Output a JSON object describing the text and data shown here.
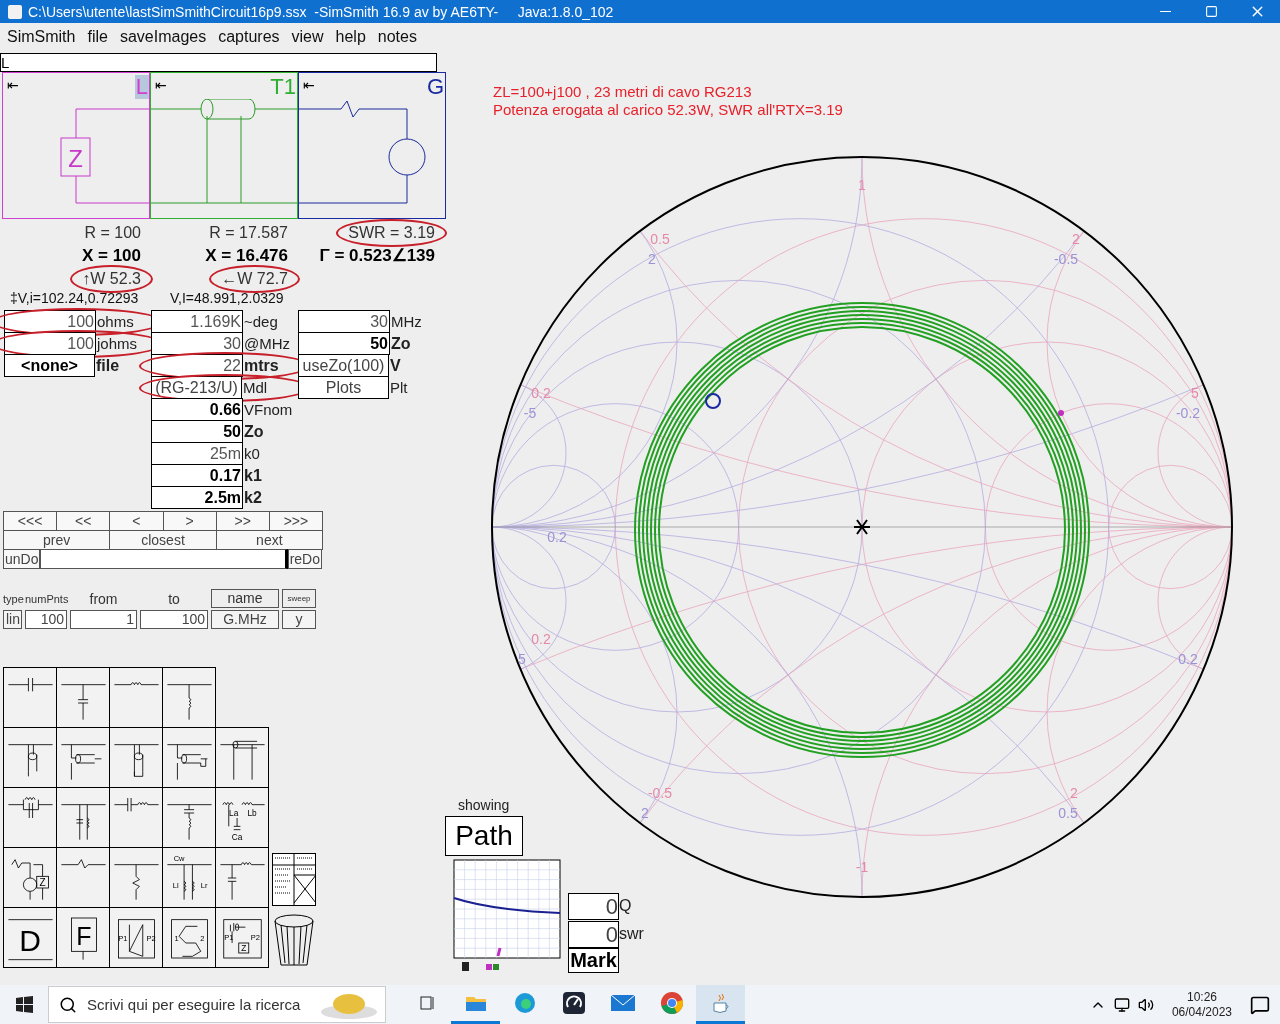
{
  "window": {
    "title": "C:\\Users\\utente\\lastSimSmithCircuit16p9.ssx  -SimSmith 16.9 av by AE6TY-     Java:1.8.0_102"
  },
  "menu": [
    "SimSmith",
    "file",
    "saveImages",
    "captures",
    "view",
    "help",
    "notes"
  ],
  "command_field": {
    "value": "L"
  },
  "circuit": [
    {
      "kind": "load",
      "label": "L",
      "back_mark": "⇤",
      "symbol": "Z",
      "selected": true
    },
    {
      "kind": "line",
      "label": "T1",
      "back_mark": "⇤",
      "selected": false
    },
    {
      "kind": "generator",
      "label": "G",
      "back_mark": "⇤",
      "selected": false
    }
  ],
  "readouts": [
    {
      "lines": [
        {
          "text": "R = 100",
          "circled": false
        },
        {
          "text": "X = 100",
          "circled": false
        },
        {
          "text": "↑W 52.3",
          "circled": true
        }
      ]
    },
    {
      "lines": [
        {
          "text": "R = 17.587",
          "circled": false
        },
        {
          "text": "X = 16.476",
          "circled": false
        },
        {
          "text": "←W 72.7",
          "circled": true
        }
      ]
    },
    {
      "lines": [
        {
          "text": "SWR = 3.19",
          "circled": true
        },
        {
          "text": "Γ = 0.523∠139",
          "circled": false
        }
      ]
    }
  ],
  "vi": [
    "‡V,i=102.24,0.72293",
    "V,I=48.991,2.0329"
  ],
  "field_groups": [
    {
      "fields": [
        {
          "kind": "input",
          "value": "100",
          "unit": "ohms",
          "bold": false,
          "unit_bold": false,
          "circled": true
        },
        {
          "kind": "input",
          "value": "100",
          "unit": "johms",
          "bold": false,
          "unit_bold": false,
          "circled": true
        },
        {
          "kind": "button",
          "value": "<none>",
          "unit": "file",
          "bold": true,
          "unit_bold": true,
          "circled": false
        }
      ]
    },
    {
      "fields": [
        {
          "kind": "input",
          "value": "1.169K",
          "unit": "~deg",
          "bold": false,
          "unit_bold": false,
          "circled": false
        },
        {
          "kind": "input",
          "value": "30",
          "unit": "@MHz",
          "bold": false,
          "unit_bold": false,
          "circled": false
        },
        {
          "kind": "input",
          "value": "22",
          "unit": "mtrs",
          "bold": false,
          "unit_bold": true,
          "circled": true
        },
        {
          "kind": "button",
          "value": "(RG-213/U)",
          "unit": "Mdl",
          "bold": false,
          "unit_bold": false,
          "circled": true
        },
        {
          "kind": "input",
          "value": "0.66",
          "unit": "VFnom",
          "bold": true,
          "unit_bold": false,
          "circled": false
        },
        {
          "kind": "input",
          "value": "50",
          "unit": "Zo",
          "bold": true,
          "unit_bold": true,
          "circled": false
        },
        {
          "kind": "input",
          "value": "25m",
          "unit": "k0",
          "bold": false,
          "unit_bold": false,
          "circled": false
        },
        {
          "kind": "input",
          "value": "0.17",
          "unit": "k1",
          "bold": true,
          "unit_bold": true,
          "circled": false
        },
        {
          "kind": "input",
          "value": "2.5m",
          "unit": "k2",
          "bold": true,
          "unit_bold": true,
          "circled": false
        }
      ]
    },
    {
      "fields": [
        {
          "kind": "input",
          "value": "30",
          "unit": "MHz",
          "bold": false,
          "unit_bold": false,
          "circled": false
        },
        {
          "kind": "input",
          "value": "50",
          "unit": "Zo",
          "bold": true,
          "unit_bold": true,
          "circled": false
        },
        {
          "kind": "button",
          "value": "useZo(100)",
          "unit": "V",
          "bold": false,
          "unit_bold": true,
          "circled": false
        },
        {
          "kind": "button",
          "value": "Plots",
          "unit": "Plt",
          "bold": false,
          "unit_bold": false,
          "circled": false
        }
      ]
    }
  ],
  "nav": {
    "step_buttons": [
      "<<<",
      "<<",
      "<",
      ">",
      ">>",
      ">>>"
    ],
    "search_buttons": [
      "prev",
      "closest",
      "next"
    ],
    "undo": "unDo",
    "redo": "reDo"
  },
  "sweep": {
    "headers": [
      {
        "text": "type",
        "kind": "small"
      },
      {
        "text": "numPnts",
        "kind": "small"
      },
      {
        "text": "from",
        "kind": "plain"
      },
      {
        "text": "to",
        "kind": "plain"
      },
      {
        "text": "name",
        "kind": "boxed"
      },
      {
        "text": "sweep",
        "kind": "tiny"
      }
    ],
    "values": [
      {
        "text": "lin",
        "kind": "button"
      },
      {
        "text": "100",
        "kind": "input"
      },
      {
        "text": "1",
        "kind": "input"
      },
      {
        "text": "100",
        "kind": "input"
      },
      {
        "text": "G.MHz",
        "kind": "button"
      },
      {
        "text": "y",
        "kind": "button"
      }
    ]
  },
  "palette": [
    [
      {
        "kind": "series-c"
      },
      {
        "kind": "shunt-c"
      },
      {
        "kind": "series-l"
      },
      {
        "kind": "shunt-l"
      }
    ],
    [
      {
        "kind": "stub-open"
      },
      {
        "kind": "line-open"
      },
      {
        "kind": "stub-short"
      },
      {
        "kind": "line-short"
      },
      {
        "kind": "tline"
      }
    ],
    [
      {
        "kind": "parallel-lc-series"
      },
      {
        "kind": "parallel-lc-shunt"
      },
      {
        "kind": "series-lc"
      },
      {
        "kind": "series-lc-shunt"
      },
      {
        "kind": "tee",
        "labels": [
          "La",
          "Lb",
          "Ca"
        ]
      }
    ],
    [
      {
        "kind": "source",
        "labels": [
          "Z"
        ]
      },
      {
        "kind": "series-r"
      },
      {
        "kind": "shunt-r"
      },
      {
        "kind": "coupled",
        "labels": [
          "Cw",
          "Ll",
          "Lr"
        ]
      },
      {
        "kind": "lowpass"
      }
    ],
    [
      {
        "kind": "letter-box",
        "labels": [
          "D"
        ]
      },
      {
        "kind": "framed-letter",
        "labels": [
          "F"
        ]
      },
      {
        "kind": "n-box",
        "labels": [
          "P1",
          "P2"
        ]
      },
      {
        "kind": "s-box",
        "labels": [
          "1",
          "2"
        ]
      },
      {
        "kind": "network",
        "labels": [
          "P1",
          "P2",
          "Z"
        ]
      }
    ]
  ],
  "annotation": [
    "ZL=100+j100 , 23 metri di cavo RG213",
    "Potenza erogata al carico 52.3W, SWR all'RTX=3.19"
  ],
  "smith": {
    "scale_labels": [
      {
        "text": "1",
        "kind": "impedance"
      },
      {
        "text": "0.5",
        "kind": "impedance"
      },
      {
        "text": "2",
        "kind": "admittance"
      },
      {
        "text": "2",
        "kind": "impedance"
      },
      {
        "text": "-0.5",
        "kind": "admittance"
      },
      {
        "text": "0.2",
        "kind": "impedance"
      },
      {
        "text": "-5",
        "kind": "admittance"
      },
      {
        "text": "5",
        "kind": "impedance"
      },
      {
        "text": "-0.2",
        "kind": "admittance"
      },
      {
        "text": "0.2",
        "kind": "admittance"
      },
      {
        "text": "0.2",
        "kind": "impedance"
      },
      {
        "text": "5",
        "kind": "admittance"
      },
      {
        "text": "0.2",
        "kind": "admittance"
      },
      {
        "text": "-0.5",
        "kind": "impedance"
      },
      {
        "text": "2",
        "kind": "admittance"
      },
      {
        "text": "2",
        "kind": "impedance"
      },
      {
        "text": "0.5",
        "kind": "admittance"
      },
      {
        "text": "-1",
        "kind": "impedance"
      }
    ]
  },
  "path_panel": {
    "caption": "showing",
    "mode": "Path",
    "fields": [
      {
        "value": "0",
        "unit": "Q"
      },
      {
        "value": "0",
        "unit": "swr"
      }
    ],
    "mark": "Mark"
  },
  "taskbar": {
    "search_placeholder": "Scrivi qui per eseguire la ricerca",
    "apps": [
      {
        "kind": "task-view",
        "running": false,
        "selected": false
      },
      {
        "kind": "folder",
        "running": true,
        "selected": false
      },
      {
        "kind": "browser",
        "running": false,
        "selected": false
      },
      {
        "kind": "gauge",
        "running": false,
        "selected": false
      },
      {
        "kind": "mail",
        "running": false,
        "selected": false
      },
      {
        "kind": "chrome",
        "running": false,
        "selected": false
      },
      {
        "kind": "java",
        "running": true,
        "selected": true
      }
    ],
    "time": "10:26",
    "date": "06/04/2023"
  }
}
